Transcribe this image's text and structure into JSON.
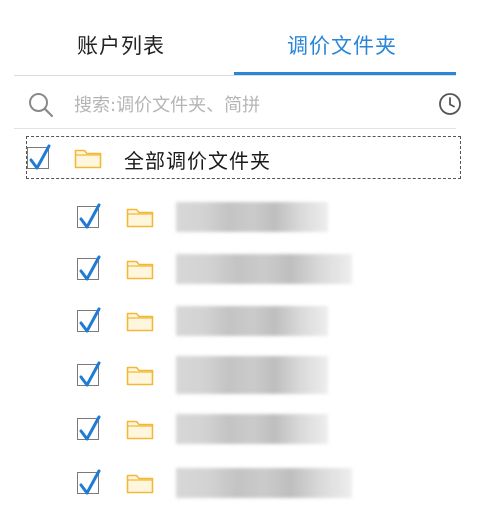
{
  "tabs": {
    "accounts_label": "账户列表",
    "folders_label": "调价文件夹",
    "active": "folders"
  },
  "search": {
    "placeholder": "搜索:调价文件夹、简拼",
    "value": ""
  },
  "tree": {
    "root": {
      "label": "全部调价文件夹",
      "checked": true
    },
    "children_checked": [
      true,
      true,
      true,
      true,
      true,
      true
    ]
  },
  "colors": {
    "accent": "#2a86d8",
    "folder": "#f7c75a",
    "check": "#1e7bd6"
  },
  "icons": [
    "search-icon",
    "clock-icon",
    "checkmark-icon",
    "folder-icon"
  ]
}
